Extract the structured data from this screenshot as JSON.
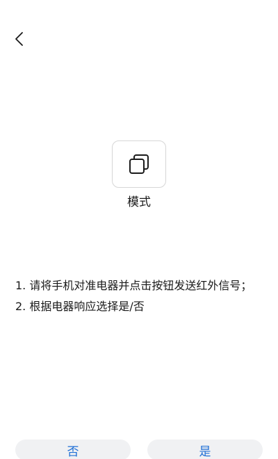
{
  "header": {
    "back_icon": "chevron-left-icon"
  },
  "mode": {
    "icon": "copy-layers-icon",
    "label": "模式"
  },
  "instructions": {
    "line1": "1. 请将手机对准电器并点击按钮发送红外信号；",
    "line2": "2. 根据电器响应选择是/否"
  },
  "actions": {
    "no_label": "否",
    "yes_label": "是"
  },
  "colors": {
    "accent": "#1f6fd6",
    "button_bg": "#f0f1f3",
    "card_border": "#d6d6d6"
  }
}
